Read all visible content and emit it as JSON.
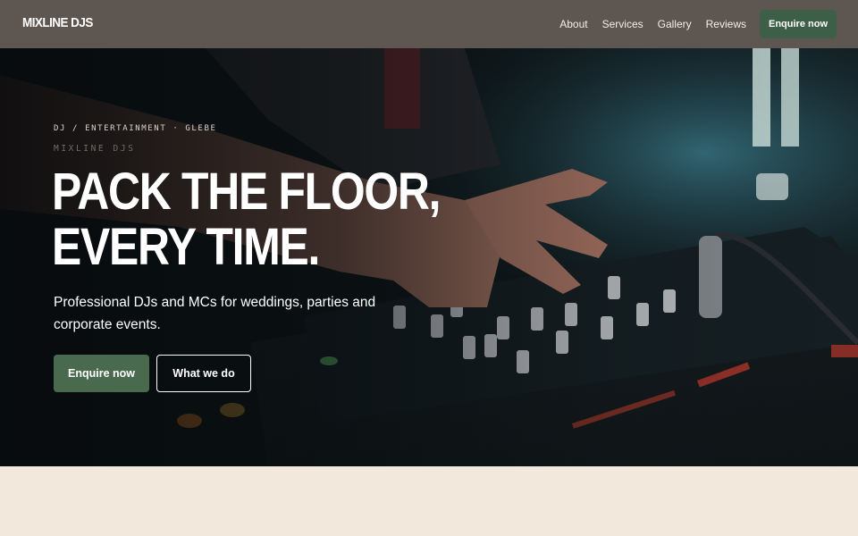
{
  "header": {
    "logo": "MIXLINE DJS",
    "nav": [
      "About",
      "Services",
      "Gallery",
      "Reviews"
    ],
    "cta": "Enquire now"
  },
  "hero": {
    "image": "dj-mixer-photo",
    "eyebrow": "DJ / ENTERTAINMENT · GLEBE",
    "brand": "MIXLINE DJS",
    "headline_lines": [
      "PACK THE FLOOR,",
      "EVERY TIME."
    ],
    "subtitle": "Professional DJs and MCs for weddings, parties and corporate events.",
    "primary_button": "Enquire now",
    "secondary_button": "What we do"
  },
  "colors": {
    "header_bg": "#5e5650",
    "accent": "#3e5f47",
    "page_bg": "#f2e8dc"
  }
}
